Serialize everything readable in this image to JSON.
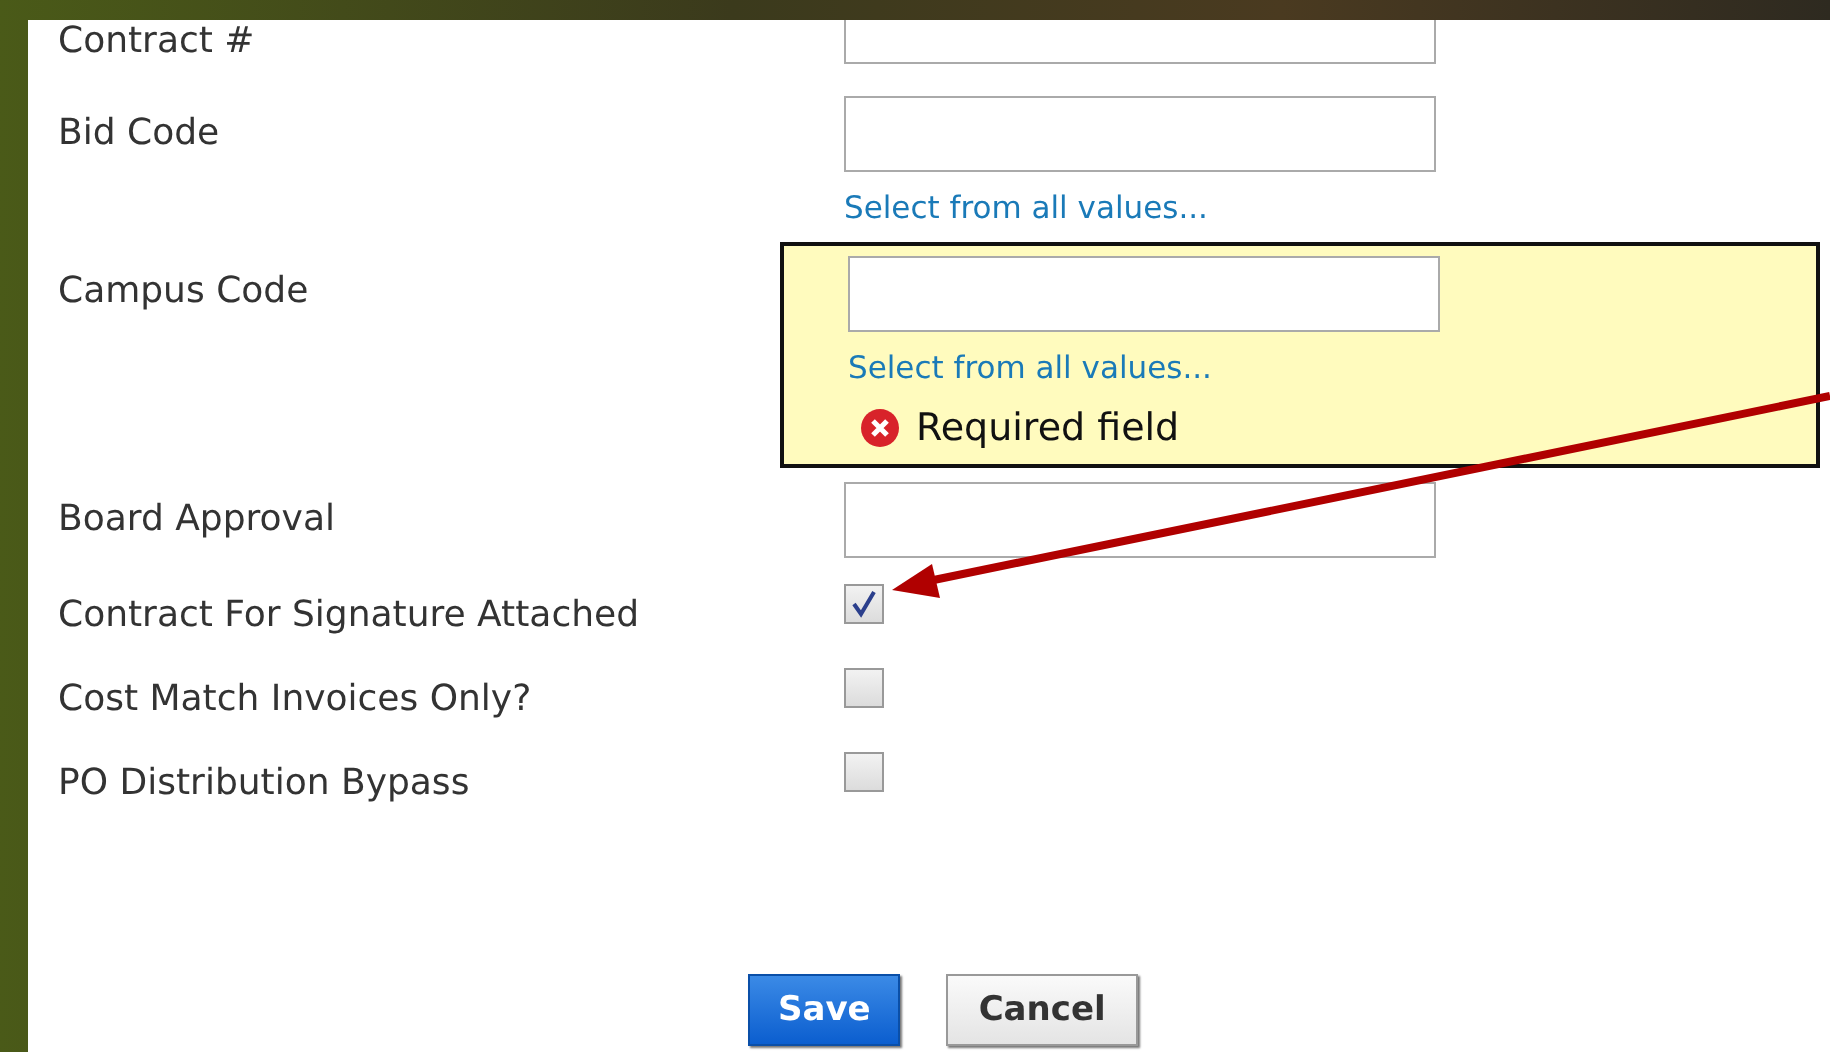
{
  "fields": [
    {
      "label": "Contract #",
      "kind": "text"
    },
    {
      "label": "Bid Code",
      "kind": "lookup",
      "link": "Select from all values..."
    },
    {
      "label": "Campus Code",
      "kind": "lookup",
      "link": "Select from all values...",
      "error": "Required field"
    },
    {
      "label": "Board Approval",
      "kind": "text"
    },
    {
      "label": "Contract For Signature Attached",
      "kind": "checkbox",
      "checked": true
    },
    {
      "label": "Cost Match Invoices Only?",
      "kind": "checkbox",
      "checked": false
    },
    {
      "label": "PO Distribution Bypass",
      "kind": "checkbox",
      "checked": false
    }
  ],
  "buttons": [
    {
      "label": "Save",
      "kind": "primary"
    },
    {
      "label": "Cancel",
      "kind": "secondary"
    }
  ]
}
